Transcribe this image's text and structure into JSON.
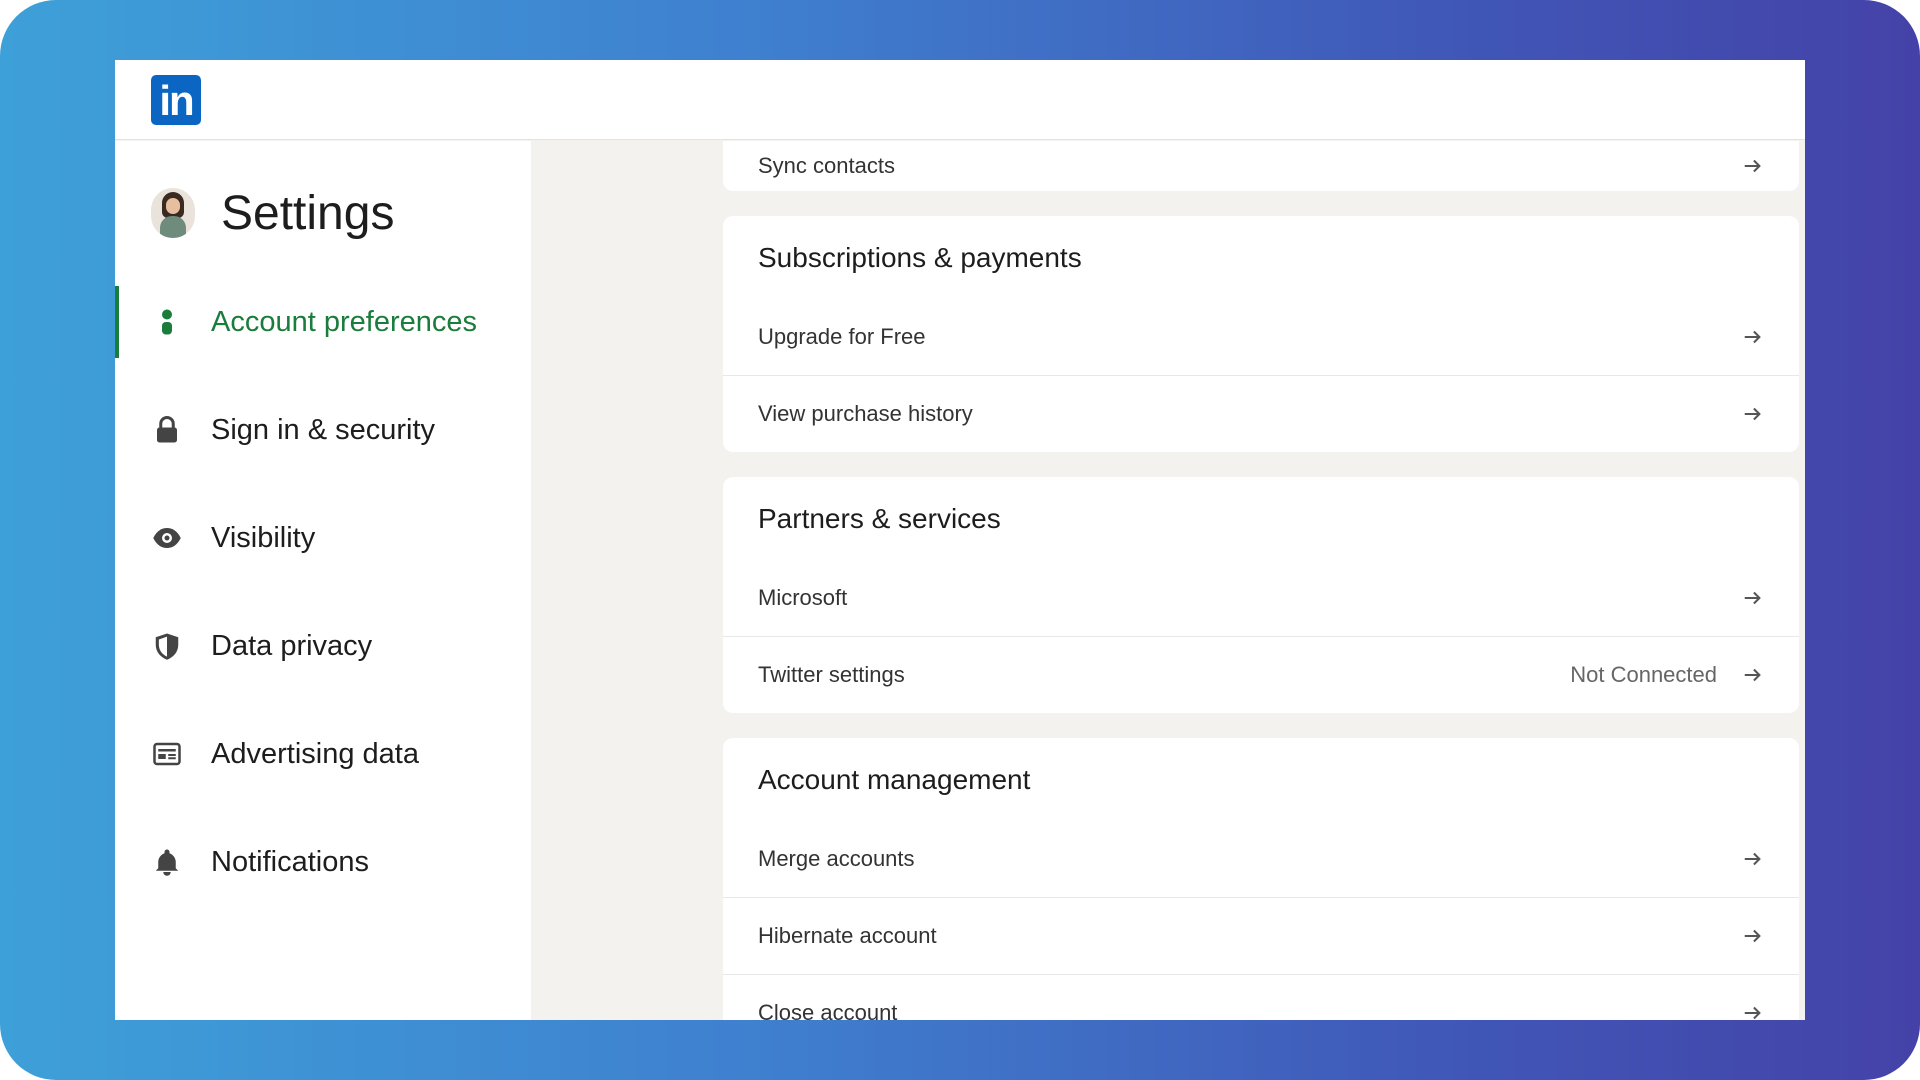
{
  "header": {
    "logo_text": "in",
    "brand_color": "#0a66c2"
  },
  "sidebar": {
    "title": "Settings",
    "active_color": "#1a7d3c",
    "items": [
      {
        "label": "Account preferences",
        "icon": "person-icon",
        "active": true
      },
      {
        "label": "Sign in & security",
        "icon": "lock-icon",
        "active": false
      },
      {
        "label": "Visibility",
        "icon": "eye-icon",
        "active": false
      },
      {
        "label": "Data privacy",
        "icon": "shield-icon",
        "active": false
      },
      {
        "label": "Advertising data",
        "icon": "ad-card-icon",
        "active": false
      },
      {
        "label": "Notifications",
        "icon": "bell-icon",
        "active": false
      }
    ]
  },
  "main": {
    "sync": {
      "label": "Sync contacts"
    },
    "subscriptions": {
      "title": "Subscriptions & payments",
      "rows": [
        {
          "label": "Upgrade for Free"
        },
        {
          "label": "View purchase history"
        }
      ]
    },
    "partners": {
      "title": "Partners & services",
      "rows": [
        {
          "label": "Microsoft",
          "status": ""
        },
        {
          "label": "Twitter settings",
          "status": "Not Connected"
        }
      ]
    },
    "account_management": {
      "title": "Account management",
      "rows": [
        {
          "label": "Merge accounts"
        },
        {
          "label": "Hibernate account"
        },
        {
          "label": "Close account"
        }
      ]
    }
  }
}
